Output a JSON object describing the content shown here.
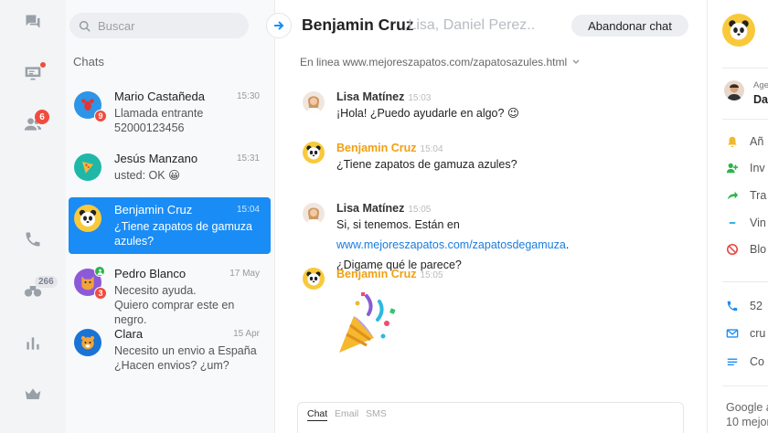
{
  "colors": {
    "accent": "#1a8cf5",
    "agent_orange": "#f0a010",
    "badge_red": "#f04c3e",
    "online_green": "#2bb44a"
  },
  "rail": {
    "badges": {
      "visitors_count": "6",
      "archive_count": "266"
    },
    "icons": [
      "chats-icon",
      "monitor-icon",
      "visitors-icon",
      "phone-icon",
      "binoculars-icon",
      "stats-icon",
      "crown-icon"
    ]
  },
  "list": {
    "search_placeholder": "Buscar",
    "title": "Chats",
    "items": [
      {
        "name": "Mario Castañeda",
        "time": "15:30",
        "line1": "Llamada entrante",
        "line2": "52000123456",
        "badge": "9"
      },
      {
        "name": "Jesús Manzano",
        "time": "15:31",
        "line1": "usted: OK 😀"
      },
      {
        "name": "Benjamin Cruz",
        "time": "15:04",
        "line1": "¿Tiene zapatos de gamuza",
        "line2": "azules?"
      },
      {
        "name": "Pedro Blanco",
        "time": "17 May",
        "line1": "Necesito ayuda.",
        "line2": "Quiero comprar este en negro.",
        "badge": "3"
      },
      {
        "name": "Clara",
        "time": "15 Apr",
        "line1": "Necesito un envio a España",
        "line2": "¿Hacen envios? ¿um?"
      }
    ]
  },
  "header": {
    "name": "Benjamin Cruz",
    "others": ",Lisa, Daniel Perez..",
    "leave_button": "Abandonar chat",
    "status": "En linea www.mejoreszapatos.com/zapatosazules.html"
  },
  "messages": [
    {
      "author": "Lisa Matínez",
      "time": "15:03",
      "text": "¡Hola! ¿Puedo ayudarle en algo? 😉"
    },
    {
      "author": "Benjamin Cruz",
      "time": "15:04",
      "text": "¿Tiene zapatos de gamuza azules?"
    },
    {
      "author": "Lisa Matínez",
      "time": "15:05",
      "text_before": "Si, si tenemos. Están en ",
      "link": "www.mejoreszapatos.com/zapatosdegamuza",
      "text_after": ".",
      "text2": "¿Digame qué le parece?"
    },
    {
      "author": "Benjamin Cruz",
      "time": "15:05",
      "sticker": "party-popper"
    }
  ],
  "composer": {
    "tabs": [
      "Chat",
      "Email",
      "SMS"
    ],
    "active_tab": "Chat"
  },
  "right_panel": {
    "agent_label": "Age",
    "agent_name": "Da",
    "actions": [
      "Añ",
      "Inv",
      "Tra",
      "Vin",
      "Blo"
    ],
    "contact": [
      "52",
      "cru",
      "Co"
    ],
    "footer_line1": "Google a",
    "footer_line2": "10 mejor"
  }
}
